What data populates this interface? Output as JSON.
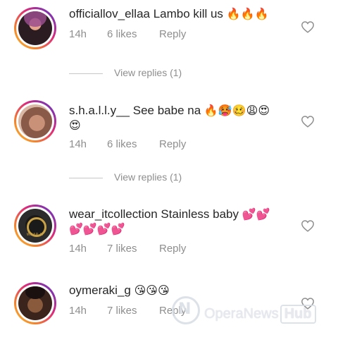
{
  "comments": [
    {
      "username": "officiallov_ellaa",
      "text": "Lambo kill us",
      "emojis": "🔥🔥🔥",
      "time": "14h",
      "likes": "6 likes",
      "reply": "Reply",
      "view_replies": "View replies (1)"
    },
    {
      "username": "s.h.a.l.l.y__",
      "text": "See babe na",
      "emojis": "🔥🥵🥴😩😍",
      "emojis_line2": "😍",
      "time": "14h",
      "likes": "6 likes",
      "reply": "Reply",
      "view_replies": "View replies (1)"
    },
    {
      "username": "wear_itcollection",
      "text": "Stainless baby",
      "emojis": "💕💕",
      "emojis_line2": "💕💕💕💕",
      "time": "14h",
      "likes": "7 likes",
      "reply": "Reply"
    },
    {
      "username": "oymeraki_g",
      "text": "",
      "emojis": "😘😘😘",
      "time": "14h",
      "likes": "7 likes",
      "reply": "Reply"
    }
  ],
  "watermark": {
    "brand": "OperaNews",
    "hub": "Hub"
  },
  "icons": {
    "like": "heart-outline-icon"
  },
  "colors": {
    "text": "#262626",
    "muted": "#8e8e8e",
    "story_ring_start": "#f9c13a",
    "story_ring_end": "#8134af"
  }
}
